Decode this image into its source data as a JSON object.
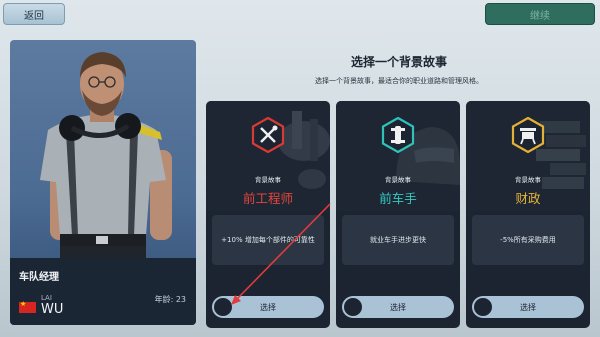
{
  "topbar": {
    "back_label": "返回",
    "continue_label": "继续"
  },
  "manager": {
    "role_title": "车队经理",
    "first_name": "LAI",
    "last_name": "WU",
    "age_text": "年龄: 23",
    "flag_color": "#d7261f"
  },
  "header": {
    "title": "选择一个背景故事",
    "subtitle": "选择一个背景故事，最适合你的职业道路和管理风格。"
  },
  "backgrounds": [
    {
      "kicker": "背景故事",
      "name": "前工程师",
      "name_color": "#e2463a",
      "emblem_icon": "wrench-screwdriver-icon",
      "emblem_color": "#d83a34",
      "description": "+10% 增加每个部件的可靠性",
      "select_label": "选择"
    },
    {
      "kicker": "背景故事",
      "name": "前车手",
      "name_color": "#36c8c0",
      "emblem_icon": "race-car-icon",
      "emblem_color": "#2ec2b8",
      "description": "就业车手进步更快",
      "select_label": "选择"
    },
    {
      "kicker": "背景故事",
      "name": "财政",
      "name_color": "#e7b43a",
      "emblem_icon": "money-stack-icon",
      "emblem_color": "#e4b035",
      "description": "-5%所有采购费用",
      "select_label": "选择"
    }
  ]
}
